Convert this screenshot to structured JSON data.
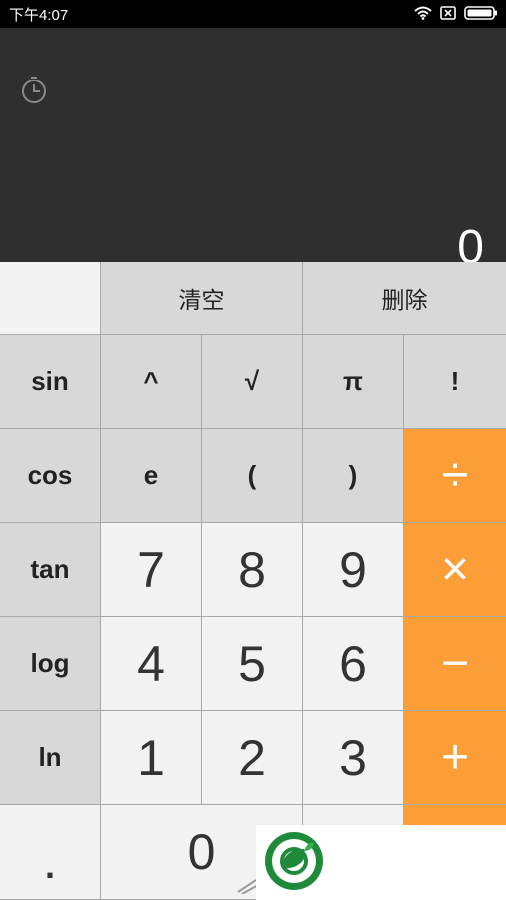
{
  "status_bar": {
    "time": "下午4:07",
    "icons": [
      "wifi-icon",
      "sim-blocked-icon",
      "battery-icon"
    ]
  },
  "display": {
    "history_icon": "history-icon",
    "result": "0"
  },
  "keypad": {
    "clear_label": "清空",
    "delete_label": "删除",
    "rows": [
      [
        "sin",
        "^",
        "√",
        "π",
        "!"
      ],
      [
        "cos",
        "e",
        "(",
        ")",
        "÷"
      ],
      [
        "tan",
        "7",
        "8",
        "9",
        "×"
      ],
      [
        "log",
        "4",
        "5",
        "6",
        "−"
      ],
      [
        "ln",
        "1",
        "2",
        "3",
        "+"
      ]
    ],
    "bottom_row": [
      ".",
      "0"
    ]
  },
  "colors": {
    "display_background": "#2f2f2f",
    "operator_orange": "#fb9e37",
    "function_gray": "#d8d8d8",
    "number_light": "#f2f2f2"
  }
}
